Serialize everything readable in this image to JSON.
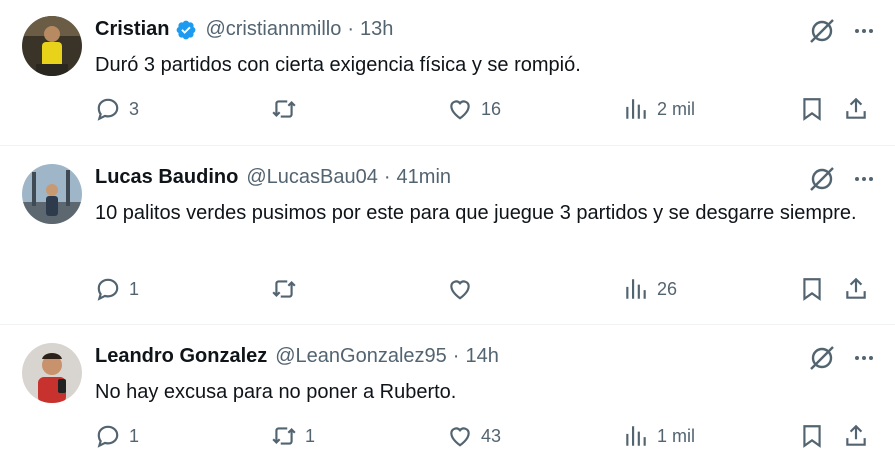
{
  "tweets": [
    {
      "name": "Cristian",
      "verified": true,
      "handle": "@cristiannmillo",
      "time": "13h",
      "text": "Duró 3 partidos con cierta exigencia física y se rompió.",
      "replies": "3",
      "retweets": "",
      "likes": "16",
      "views": "2 mil"
    },
    {
      "name": "Lucas Baudino",
      "verified": false,
      "handle": "@LucasBau04",
      "time": "41min",
      "text": "10 palitos verdes pusimos por este para que juegue 3 partidos y se desgarre siempre.",
      "replies": "1",
      "retweets": "",
      "likes": "",
      "views": "26"
    },
    {
      "name": "Leandro Gonzalez",
      "verified": false,
      "handle": "@LeanGonzalez95",
      "time": "14h",
      "text": "No hay excusa para no poner a Ruberto.",
      "replies": "1",
      "retweets": "1",
      "likes": "43",
      "views": "1 mil"
    }
  ],
  "header": {
    "separator": "·"
  },
  "colors": {
    "verified": "#1d9bf0",
    "muted": "#536471",
    "text": "#0f1419"
  }
}
